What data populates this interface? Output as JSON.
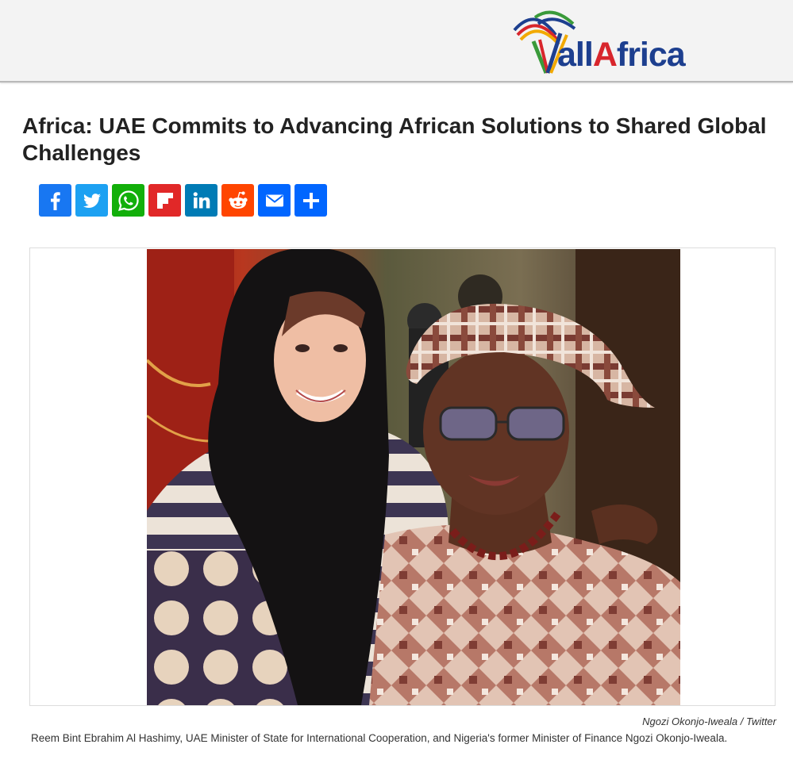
{
  "site": {
    "logo_prefix": "all",
    "logo_accent": "A",
    "logo_suffix": "frica",
    "brand_blue": "#1d3f8f",
    "brand_red": "#d8262c"
  },
  "article": {
    "title": "Africa: UAE Commits to Advancing African Solutions to Shared Global Challenges",
    "photo_credit": "Ngozi Okonjo-Iweala / Twitter",
    "caption": "Reem Bint Ebrahim Al Hashimy, UAE Minister of State for International Cooperation, and Nigeria's former Minister of Finance Ngozi Okonjo-Iweala."
  },
  "share": {
    "buttons": [
      {
        "name": "facebook",
        "icon": "facebook-icon",
        "color": "#1877f2"
      },
      {
        "name": "twitter",
        "icon": "twitter-icon",
        "color": "#1da1f2"
      },
      {
        "name": "whatsapp",
        "icon": "whatsapp-icon",
        "color": "#12af0a"
      },
      {
        "name": "flipboard",
        "icon": "flipboard-icon",
        "color": "#e12828"
      },
      {
        "name": "linkedin",
        "icon": "linkedin-icon",
        "color": "#007bb5"
      },
      {
        "name": "reddit",
        "icon": "reddit-icon",
        "color": "#ff4500"
      },
      {
        "name": "email",
        "icon": "email-icon",
        "color": "#0166ff"
      },
      {
        "name": "more",
        "icon": "plus-icon",
        "color": "#0166ff"
      }
    ]
  }
}
